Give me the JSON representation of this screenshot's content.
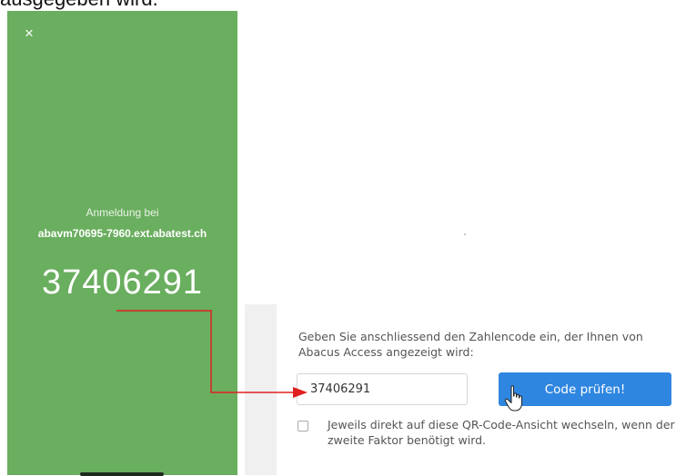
{
  "caption": {
    "text": "ausgegeben wird."
  },
  "phone": {
    "close_symbol": "×",
    "login_label": "Anmeldung bei",
    "host": "abavm70695-7960.ext.abatest.ch",
    "code": "37406291",
    "background_color": "#6aae5f"
  },
  "form": {
    "instruction": "Geben Sie anschliessend den Zahlencode ein, der Ihnen von Abacus Access angezeigt wird:",
    "code_input_value": "37406291",
    "check_button_label": "Code prüfen!",
    "checkbox_label": "Jeweils direkt auf diese QR-Code-Ansicht wechseln, wenn der zweite Faktor benötigt wird.",
    "checkbox_checked": false,
    "button_color": "#2f86e0"
  },
  "annotation": {
    "arrow_color": "#e02020",
    "icons": [
      "close-icon",
      "hand-pointer-icon",
      "arrow-annotation"
    ]
  }
}
